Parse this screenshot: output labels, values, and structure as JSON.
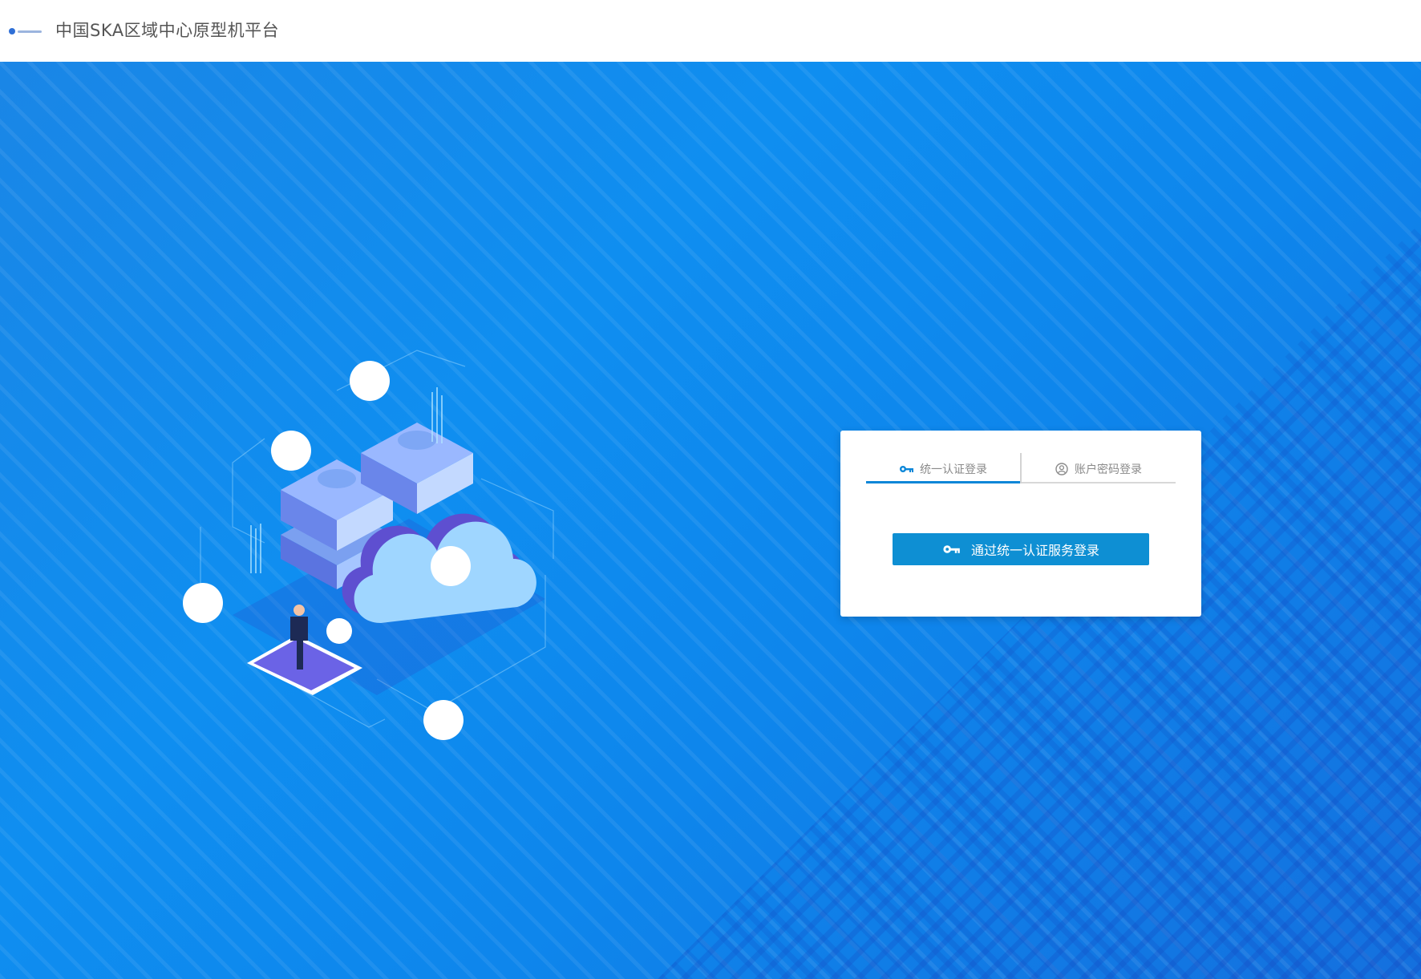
{
  "header": {
    "title": "中国SKA区域中心原型机平台",
    "logo_icon": "institution-logo-icon"
  },
  "login": {
    "tabs": [
      {
        "label": "统一认证登录",
        "icon": "key-icon",
        "active": true
      },
      {
        "label": "账户密码登录",
        "icon": "user-circle-icon",
        "active": false
      }
    ],
    "sso_button_label": "通过统一认证服务登录",
    "sso_button_icon": "key-icon"
  },
  "colors": {
    "accent": "#0b86d8",
    "button": "#0e8fd3",
    "hero_background": "#0f8ef0"
  }
}
